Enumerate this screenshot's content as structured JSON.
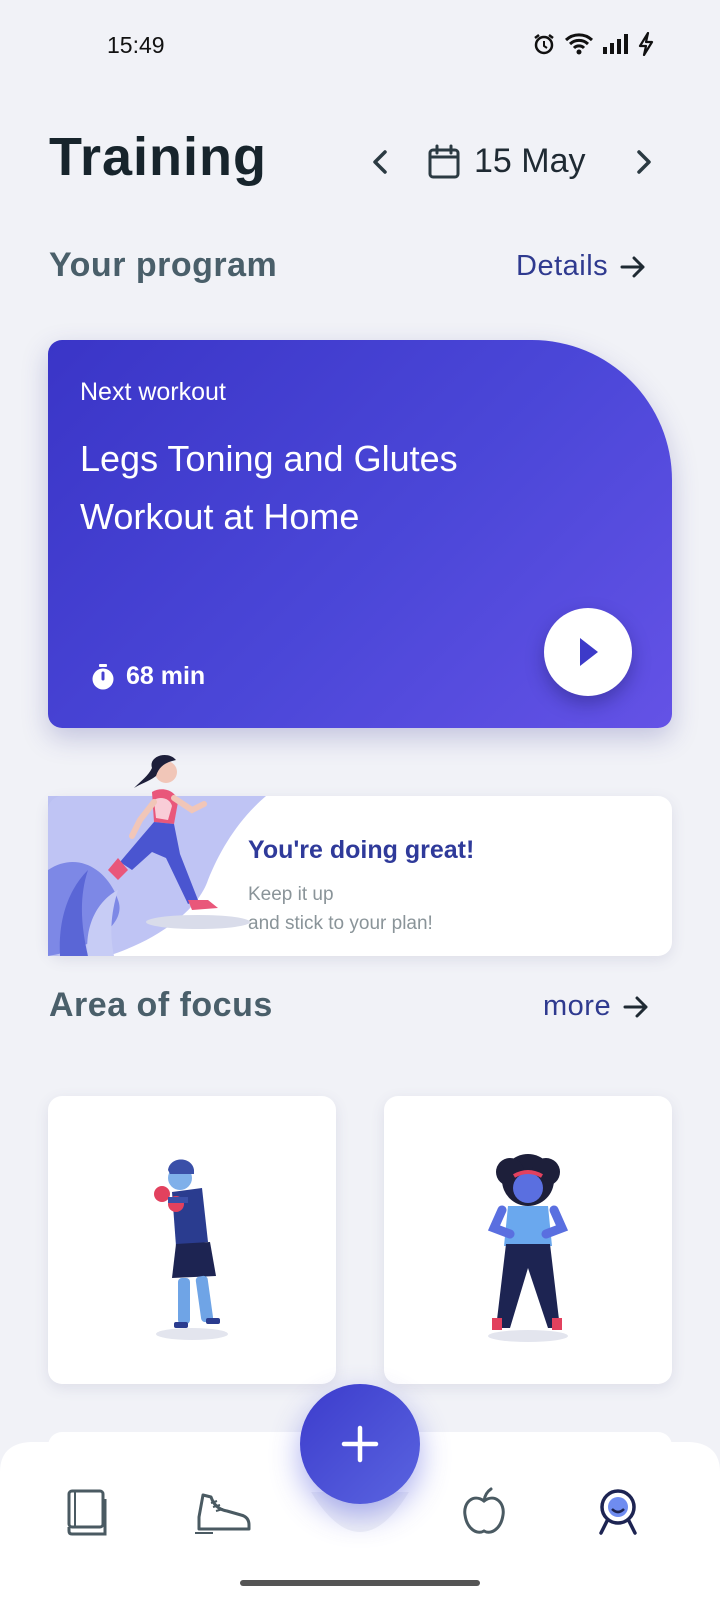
{
  "status_bar": {
    "time": "15:49",
    "icons": [
      "alarm-icon",
      "wifi-icon",
      "signal-icon",
      "charging-icon"
    ]
  },
  "header": {
    "title": "Training",
    "date": "15 May",
    "prev_icon": "chevron-left-icon",
    "next_icon": "chevron-right-icon",
    "calendar_icon": "calendar-icon"
  },
  "program": {
    "section_title": "Your program",
    "link_label": "Details",
    "card": {
      "eyebrow": "Next workout",
      "title": "Legs Toning and Glutes Workout at Home",
      "duration": "68 min",
      "timer_icon": "stopwatch-icon",
      "play_icon": "play-icon"
    }
  },
  "motivation": {
    "title": "You're doing great!",
    "line1": "Keep it up",
    "line2": "and stick to your plan!"
  },
  "focus": {
    "section_title": "Area of focus",
    "link_label": "more",
    "cards": [
      {
        "illustration": "boxer-illustration"
      },
      {
        "illustration": "woman-fitness-illustration"
      }
    ]
  },
  "bottom_nav": {
    "items": [
      "book-icon",
      "sneaker-icon",
      "apple-icon",
      "profile-icon"
    ],
    "fab_icon": "plus-icon"
  },
  "colors": {
    "background": "#f1f2f7",
    "accent": "#3a35c7",
    "link": "#2f3a8f",
    "card_gradient_end": "#6452e6"
  }
}
